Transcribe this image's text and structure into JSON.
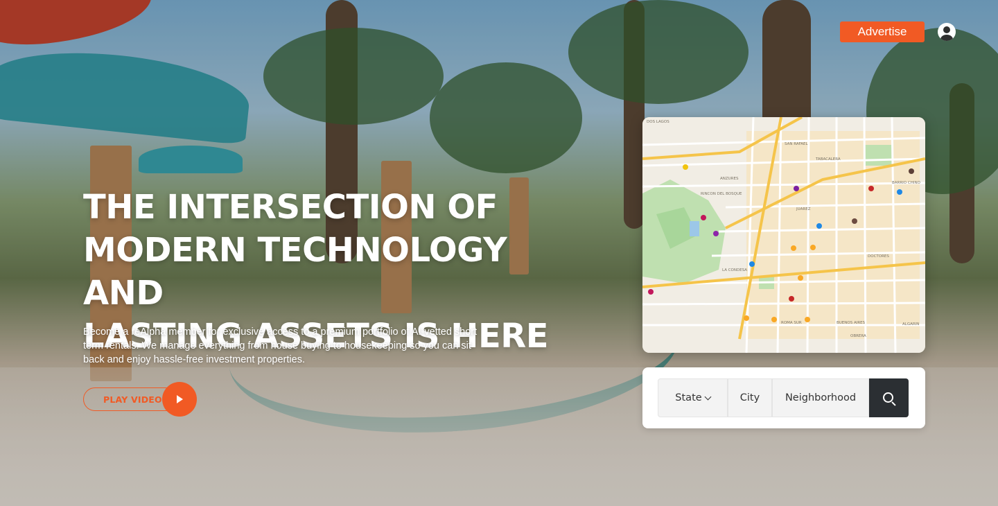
{
  "header": {
    "advertise_label": "Advertise",
    "account_icon": "user-circle-icon"
  },
  "hero": {
    "headline_lines": [
      "THE INTERSECTION OF",
      "MODERN TECHNOLOGY AND",
      "LASTING ASSETS IS HERE"
    ],
    "subcopy": "Become a reAlpha member for exclusive access to a premium portfolio of AI-vetted short term rentals. We manage everything from house buying to housekeeping so you can sit back and enjoy hassle-free investment properties.",
    "play_video_label": "PLAY VIDEO",
    "play_icon": "play-icon"
  },
  "map": {
    "labels": [
      "DOS LAGOS",
      "SAN RAFAEL",
      "TABACALERA",
      "BARRIO CHINO",
      "RINCON DEL BOSQUE",
      "ANZURES",
      "JUAREZ",
      "DOCTORES",
      "LA CONDESA",
      "ROMA SUR",
      "BUENOS AIRES",
      "ALGARIN",
      "OBRERA"
    ]
  },
  "search": {
    "state_label": "State",
    "city_label": "City",
    "neighborhood_label": "Neighborhood",
    "search_icon": "search-icon"
  },
  "colors": {
    "accent": "#f15a24",
    "search_button": "#2b2f33"
  }
}
